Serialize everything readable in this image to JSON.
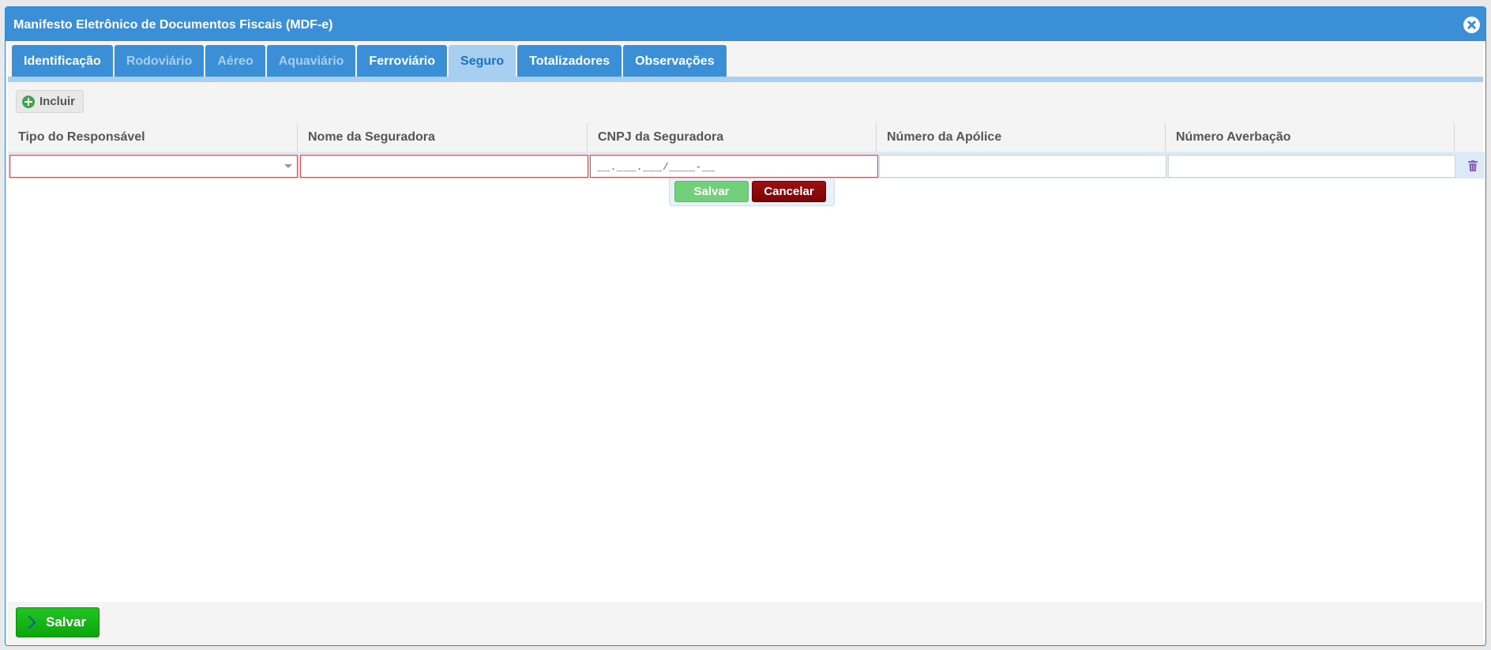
{
  "window": {
    "title": "Manifesto Eletrônico de Documentos Fiscais (MDF-e)"
  },
  "tabs": [
    {
      "label": "Identificação",
      "state": "enabled"
    },
    {
      "label": "Rodoviário",
      "state": "disabled"
    },
    {
      "label": "Aéreo",
      "state": "disabled"
    },
    {
      "label": "Aquaviário",
      "state": "disabled"
    },
    {
      "label": "Ferroviário",
      "state": "enabled"
    },
    {
      "label": "Seguro",
      "state": "active"
    },
    {
      "label": "Totalizadores",
      "state": "enabled"
    },
    {
      "label": "Observações",
      "state": "enabled"
    }
  ],
  "toolbar": {
    "include_label": "Incluir"
  },
  "grid": {
    "columns": [
      "Tipo do Responsável",
      "Nome da Seguradora",
      "CNPJ da Seguradora",
      "Número da Apólice",
      "Número Averbação"
    ],
    "edit_row": {
      "tipo_responsavel": "",
      "nome_seguradora": "",
      "cnpj_mask": "__.___.___/____-__",
      "numero_apolice": "",
      "numero_averbacao": ""
    },
    "row_save_label": "Salvar",
    "row_cancel_label": "Cancelar"
  },
  "footer": {
    "save_label": "Salvar"
  },
  "colors": {
    "accent": "#3a8fd6",
    "active_tab": "#a8cff0",
    "invalid_border": "#e04848",
    "save_green": "#0aa70a",
    "cancel_red": "#8a0a0a"
  }
}
